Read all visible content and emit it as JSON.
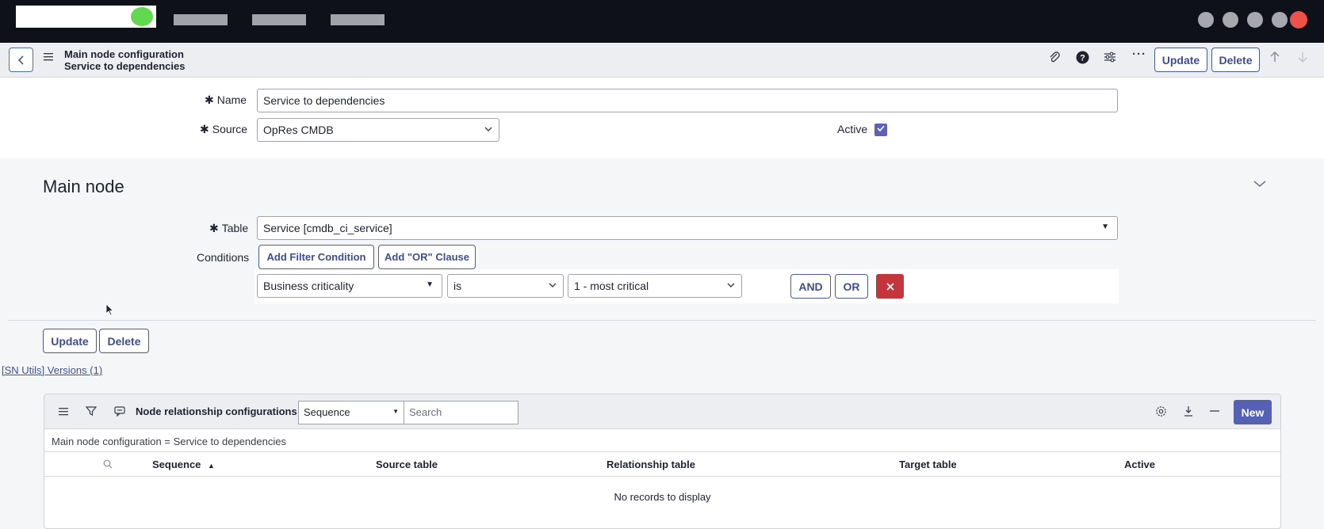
{
  "header": {
    "title_line1": "Main node configuration",
    "title_line2": "Service to dependencies",
    "update_label": "Update",
    "delete_label": "Delete"
  },
  "form": {
    "name_label": "Name",
    "name_value": "Service to dependencies",
    "source_label": "Source",
    "source_value": "OpRes CMDB",
    "active_label": "Active",
    "active_checked": true
  },
  "main_node": {
    "title": "Main node",
    "table_label": "Table",
    "table_value": "Service [cmdb_ci_service]",
    "conditions_label": "Conditions",
    "add_filter_label": "Add Filter Condition",
    "add_or_label": "Add \"OR\" Clause",
    "condition": {
      "field": "Business criticality",
      "operator": "is",
      "value": "1 - most critical"
    },
    "and_label": "AND",
    "or_label": "OR"
  },
  "bottom_buttons": {
    "update_label": "Update",
    "delete_label": "Delete"
  },
  "versions_link": "[SN Utils] Versions (1)",
  "related_list": {
    "title": "Node relationship configurations",
    "search_field": "Sequence",
    "search_placeholder": "Search",
    "new_label": "New",
    "breadcrumb": "Main node configuration = Service to dependencies",
    "columns": [
      "Sequence",
      "Source table",
      "Relationship table",
      "Target table",
      "Active"
    ],
    "sort_indicator": "▲",
    "empty_message": "No records to display"
  }
}
